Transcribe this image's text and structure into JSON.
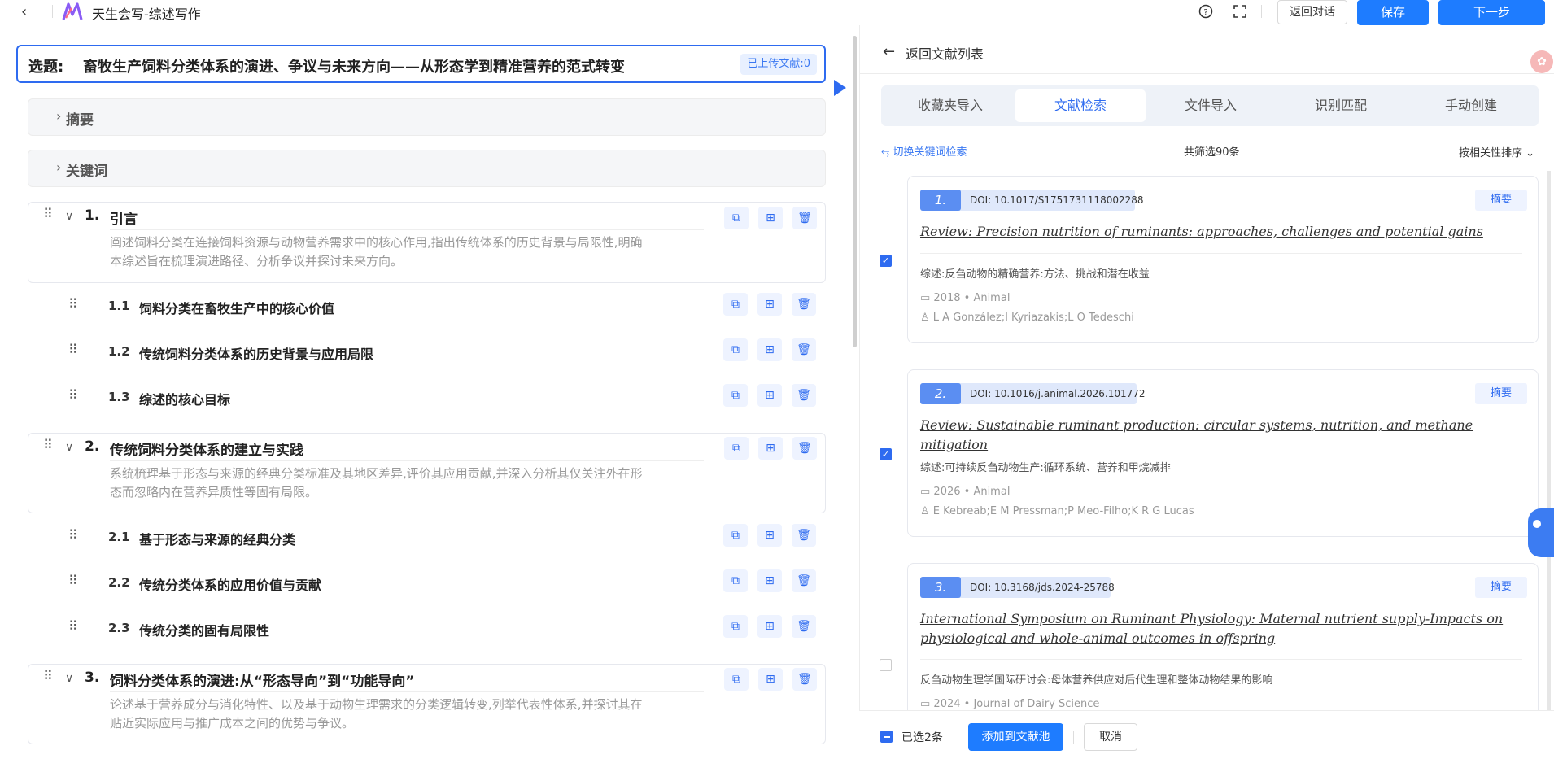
{
  "header": {
    "app_title": "天生会写-综述写作",
    "back_chat_label": "返回对话",
    "save_label": "保存",
    "next_label": "下一步"
  },
  "topic": {
    "label": "选题:",
    "text": "畜牧生产饲料分类体系的演进、争议与未来方向——从形态学到精准营养的范式转变",
    "upload_badge": "已上传文献:0"
  },
  "collapsibles": {
    "abstract": "摘要",
    "keywords": "关键词"
  },
  "sections": [
    {
      "num": "1.",
      "title": "引言",
      "desc_line1": "阐述饲料分类在连接饲料资源与动物营养需求中的核心作用,指出传统体系的历史背景与局限性,明确",
      "desc_line2": "本综述旨在梳理演进路径、分析争议并探讨未来方向。",
      "subs": [
        {
          "num": "1.1",
          "title": "饲料分类在畜牧生产中的核心价值"
        },
        {
          "num": "1.2",
          "title": "传统饲料分类体系的历史背景与应用局限"
        },
        {
          "num": "1.3",
          "title": "综述的核心目标"
        }
      ]
    },
    {
      "num": "2.",
      "title": "传统饲料分类体系的建立与实践",
      "desc_line1": "系统梳理基于形态与来源的经典分类标准及其地区差异,评价其应用贡献,并深入分析其仅关注外在形",
      "desc_line2": "态而忽略内在营养异质性等固有局限。",
      "subs": [
        {
          "num": "2.1",
          "title": "基于形态与来源的经典分类"
        },
        {
          "num": "2.2",
          "title": "传统分类体系的应用价值与贡献"
        },
        {
          "num": "2.3",
          "title": "传统分类的固有局限性"
        }
      ]
    },
    {
      "num": "3.",
      "title": "饲料分类体系的演进:从“形态导向”到“功能导向”",
      "desc_line1": "论述基于营养成分与消化特性、以及基于动物生理需求的分类逻辑转变,列举代表性体系,并探讨其在",
      "desc_line2": "贴近实际应用与推广成本之间的优势与争议。"
    }
  ],
  "right_panel": {
    "back_label": "返回文献列表",
    "tabs": [
      "收藏夹导入",
      "文献检索",
      "文件导入",
      "识别匹配",
      "手动创建"
    ],
    "active_tab": 1,
    "switch_label": "⥃ 切换关键词检索",
    "count_text": "共筛选90条",
    "sort_text": "按相关性排序 ⌄",
    "abstract_btn": "摘要",
    "references": [
      {
        "num": "1.",
        "doi": "DOI: 10.1017/S1751731118002288",
        "title": "Review: Precision nutrition of ruminants: approaches, challenges and potential gains",
        "translation": "综述:反刍动物的精确营养:方法、挑战和潜在收益",
        "meta": "2018 • Animal",
        "authors": "L A González;I Kyriazakis;L O Tedeschi",
        "checked": true
      },
      {
        "num": "2.",
        "doi": "DOI: 10.1016/j.animal.2026.101772",
        "title": "Review: Sustainable ruminant production: circular systems, nutrition, and methane mitigation",
        "translation": "综述:可持续反刍动物生产:循环系统、营养和甲烷减排",
        "meta": "2026 • Animal",
        "authors": "E Kebreab;E M Pressman;P Meo-Filho;K R G Lucas",
        "checked": true
      },
      {
        "num": "3.",
        "doi": "DOI: 10.3168/jds.2024-25788",
        "title_line1": "International Symposium on Ruminant Physiology: Maternal nutrient supply-Impacts on",
        "title_line2": "physiological and whole-animal outcomes in offspring",
        "translation": "反刍动物生理学国际研讨会:母体营养供应对后代生理和整体动物结果的影响",
        "meta": "2024 • Journal of Dairy Science",
        "checked": false
      }
    ]
  },
  "bottom_bar": {
    "selected_text": "已选2条",
    "add_label": "添加到文献池",
    "cancel_label": "取消"
  },
  "colors": {
    "accent": "#1e7cff",
    "accent_border": "#2e6bf0",
    "tab_bg": "#eef2f8"
  }
}
